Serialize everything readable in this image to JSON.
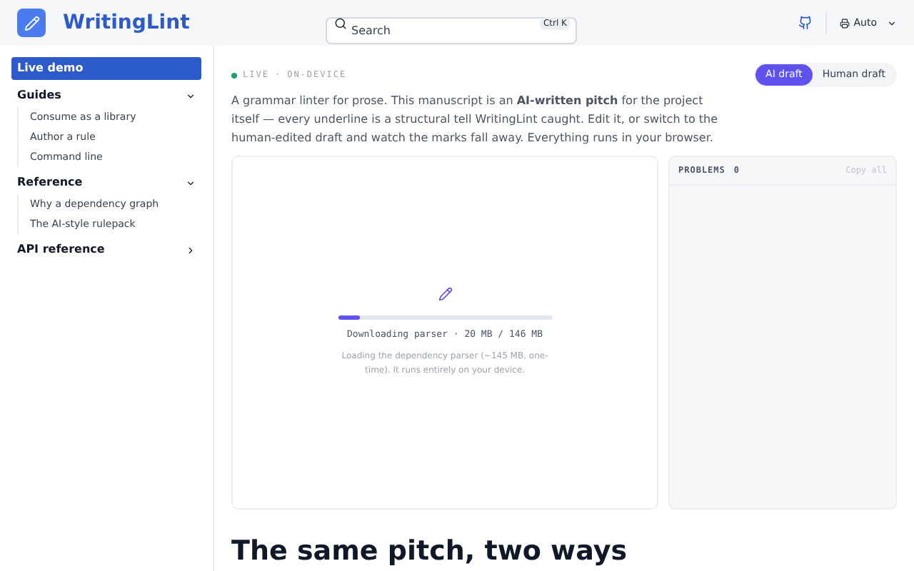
{
  "header": {
    "brand": "WritingLint",
    "search": {
      "placeholder": "Search",
      "shortcut": "Ctrl K"
    },
    "theme": "Auto"
  },
  "sidebar": {
    "items": [
      {
        "label": "Live demo",
        "selected": true,
        "expanded": false
      },
      {
        "label": "Guides",
        "selected": false,
        "expanded": true,
        "children": [
          {
            "label": "Consume as a library",
            "selected": false
          },
          {
            "label": "Author a rule",
            "selected": false
          },
          {
            "label": "Command line",
            "selected": false
          }
        ]
      },
      {
        "label": "Reference",
        "selected": false,
        "expanded": true,
        "children": [
          {
            "label": "Why a dependency graph",
            "selected": false
          },
          {
            "label": "The AI-style rulepack",
            "selected": false
          }
        ]
      },
      {
        "label": "API reference",
        "selected": false,
        "expanded": false
      }
    ]
  },
  "status": {
    "badges": [
      "LIVE",
      "ON-DEVICE"
    ],
    "separator": "·"
  },
  "tabs": [
    {
      "label": "AI draft",
      "selected": true
    },
    {
      "label": "Human draft",
      "selected": false
    }
  ],
  "intro": "A grammar linter for prose. This manuscript is an **AI-written pitch** for the project itself — every underline is a structural tell WritingLint caught. Edit it, or switch to the human-edited draft and watch the marks fall away. Everything runs in your browser.",
  "editor": {
    "progress": {
      "level": 0.1,
      "label": "Downloading parser · 20 MB / 146 MB"
    },
    "note": "Loading the dependency parser (~145 MB, one-time). It runs entirely on your device."
  },
  "problems": {
    "title": "PROBLEMS",
    "count": "0",
    "action": "Copy all"
  },
  "section_heading": "The same pitch, two ways"
}
